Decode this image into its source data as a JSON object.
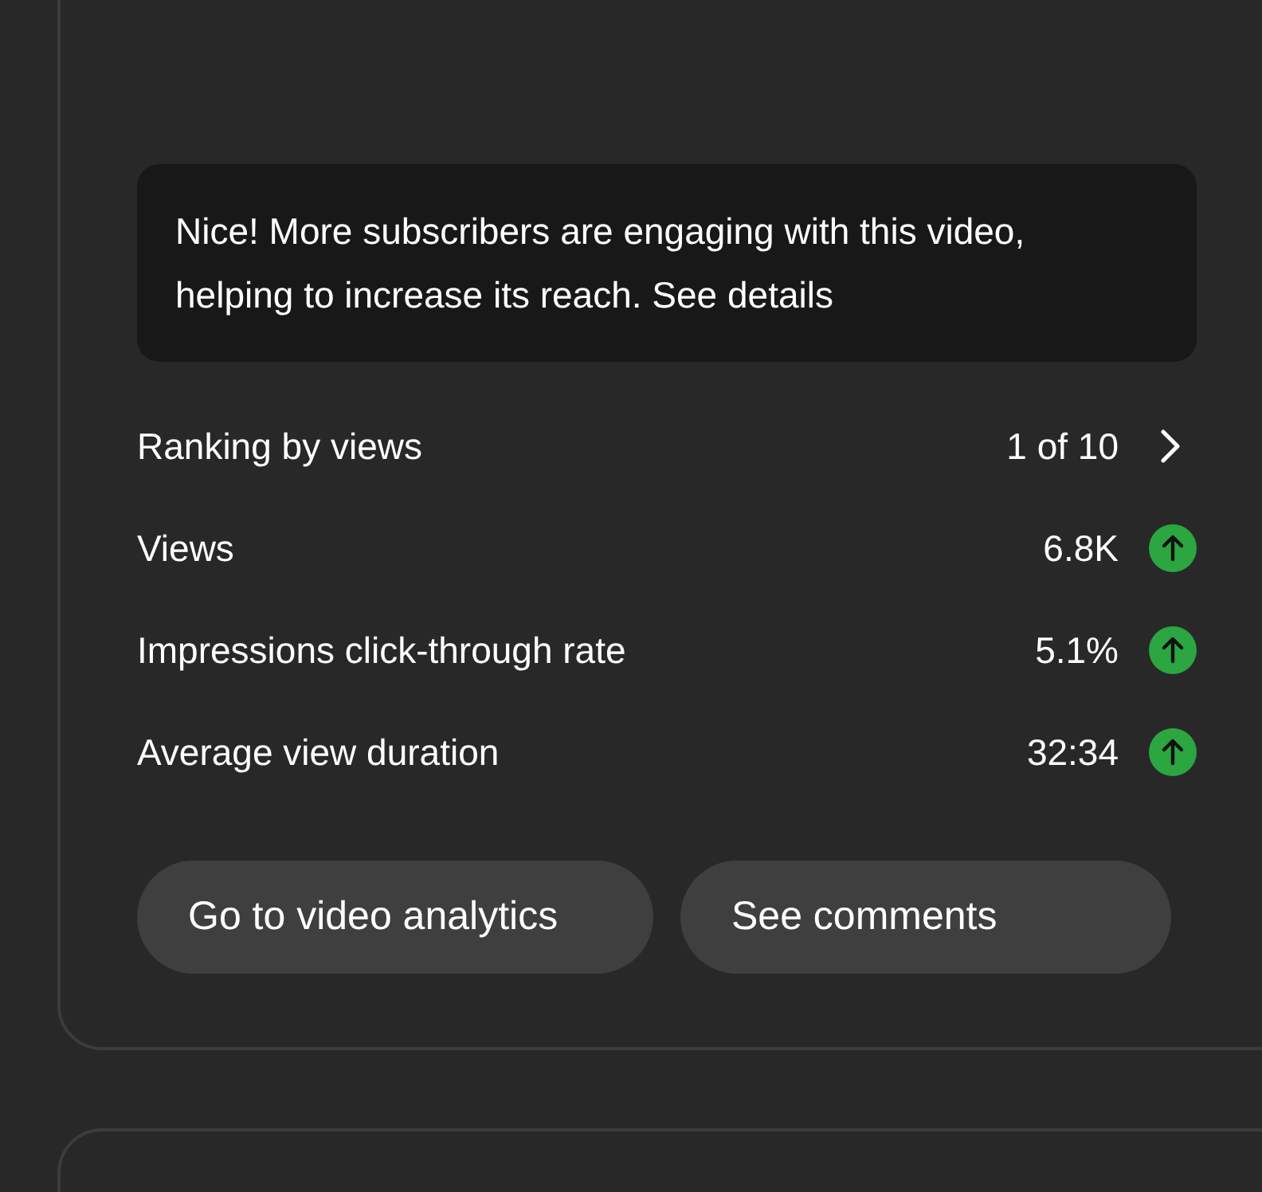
{
  "insight": {
    "text": "Nice! More subscribers are engaging with this video, helping to increase its reach. See details"
  },
  "metrics": [
    {
      "kind": "link",
      "label": "Ranking by views",
      "value": "1 of 10"
    },
    {
      "kind": "trend",
      "label": "Views",
      "value": "6.8K",
      "rising": true
    },
    {
      "kind": "trend",
      "label": "Impressions click-through rate",
      "value": "5.1%",
      "rising": true
    },
    {
      "kind": "trend",
      "label": "Average view duration",
      "value": "32:34",
      "rising": true
    }
  ],
  "buttons": [
    {
      "label": "Go to video analytics"
    },
    {
      "label": "See comments"
    }
  ]
}
